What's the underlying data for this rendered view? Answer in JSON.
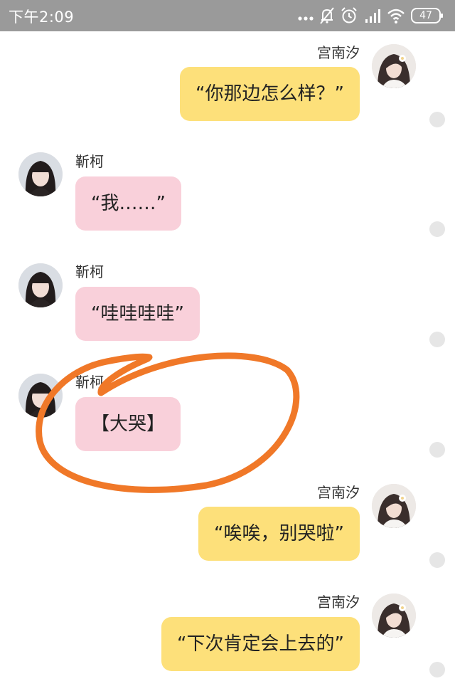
{
  "status_bar": {
    "time": "下午2:09",
    "battery": "47",
    "icons": [
      "more-dots-icon",
      "mute-bell-icon",
      "alarm-icon",
      "signal-icon",
      "wifi-icon",
      "battery-icon"
    ]
  },
  "messages": [
    {
      "side": "right",
      "sender": "宫南汐",
      "text": "“你那边怎么样？”"
    },
    {
      "side": "left",
      "sender": "靳柯",
      "text": "“我……”"
    },
    {
      "side": "left",
      "sender": "靳柯",
      "text": "“哇哇哇哇”"
    },
    {
      "side": "left",
      "sender": "靳柯",
      "text": "【大哭】"
    },
    {
      "side": "right",
      "sender": "宫南汐",
      "text": "“唉唉，别哭啦”"
    },
    {
      "side": "right",
      "sender": "宫南汐",
      "text": "“下次肯定会上去的”"
    }
  ],
  "colors": {
    "right_bubble": "#fde07a",
    "left_bubble": "#f9d0da",
    "annotation": "#f07828",
    "status_bar": "#9a9a9a"
  }
}
